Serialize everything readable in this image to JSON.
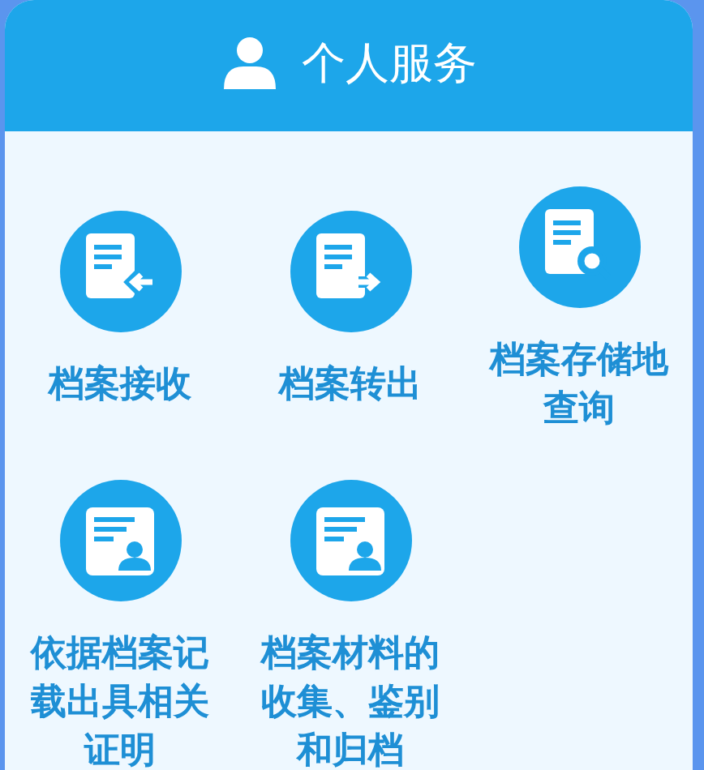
{
  "header": {
    "title": "个人服务"
  },
  "services": [
    {
      "kind": "receive",
      "label": "档案接收"
    },
    {
      "kind": "send",
      "label": "档案转出"
    },
    {
      "kind": "search",
      "label": "档案存储地查询"
    },
    {
      "kind": "certificate",
      "label": "依据档案记载出具相关证明"
    },
    {
      "kind": "certificate",
      "label": "档案材料的收集、鉴别和归档"
    }
  ]
}
